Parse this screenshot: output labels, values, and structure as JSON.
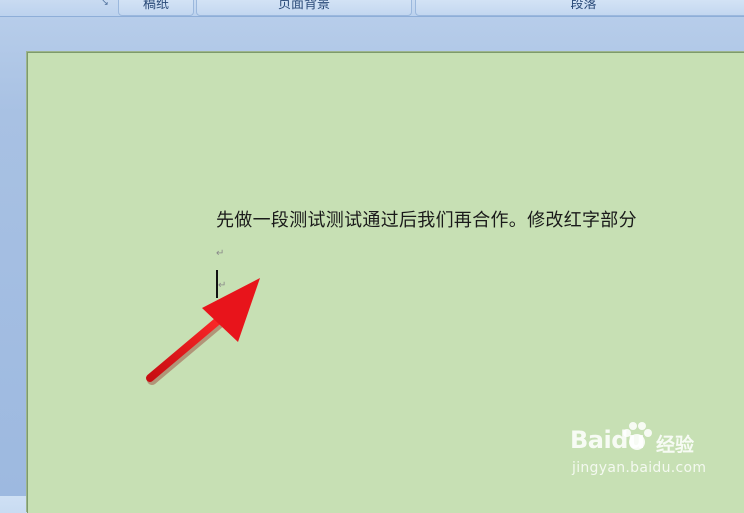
{
  "ribbon": {
    "groups": [
      "稿纸",
      "页面背景",
      "段落"
    ]
  },
  "document": {
    "line1": "先做一段测试测试通过后我们再合作。修改红字部分",
    "paragraph_mark": "↵"
  },
  "annotation": {
    "arrow_color": "#e8141b"
  },
  "watermark": {
    "brand": "Baidu",
    "suffix": "经验",
    "url": "jingyan.baidu.com"
  },
  "colors": {
    "page_background": "#c7e0b4",
    "workspace": "#a7c2e4"
  }
}
